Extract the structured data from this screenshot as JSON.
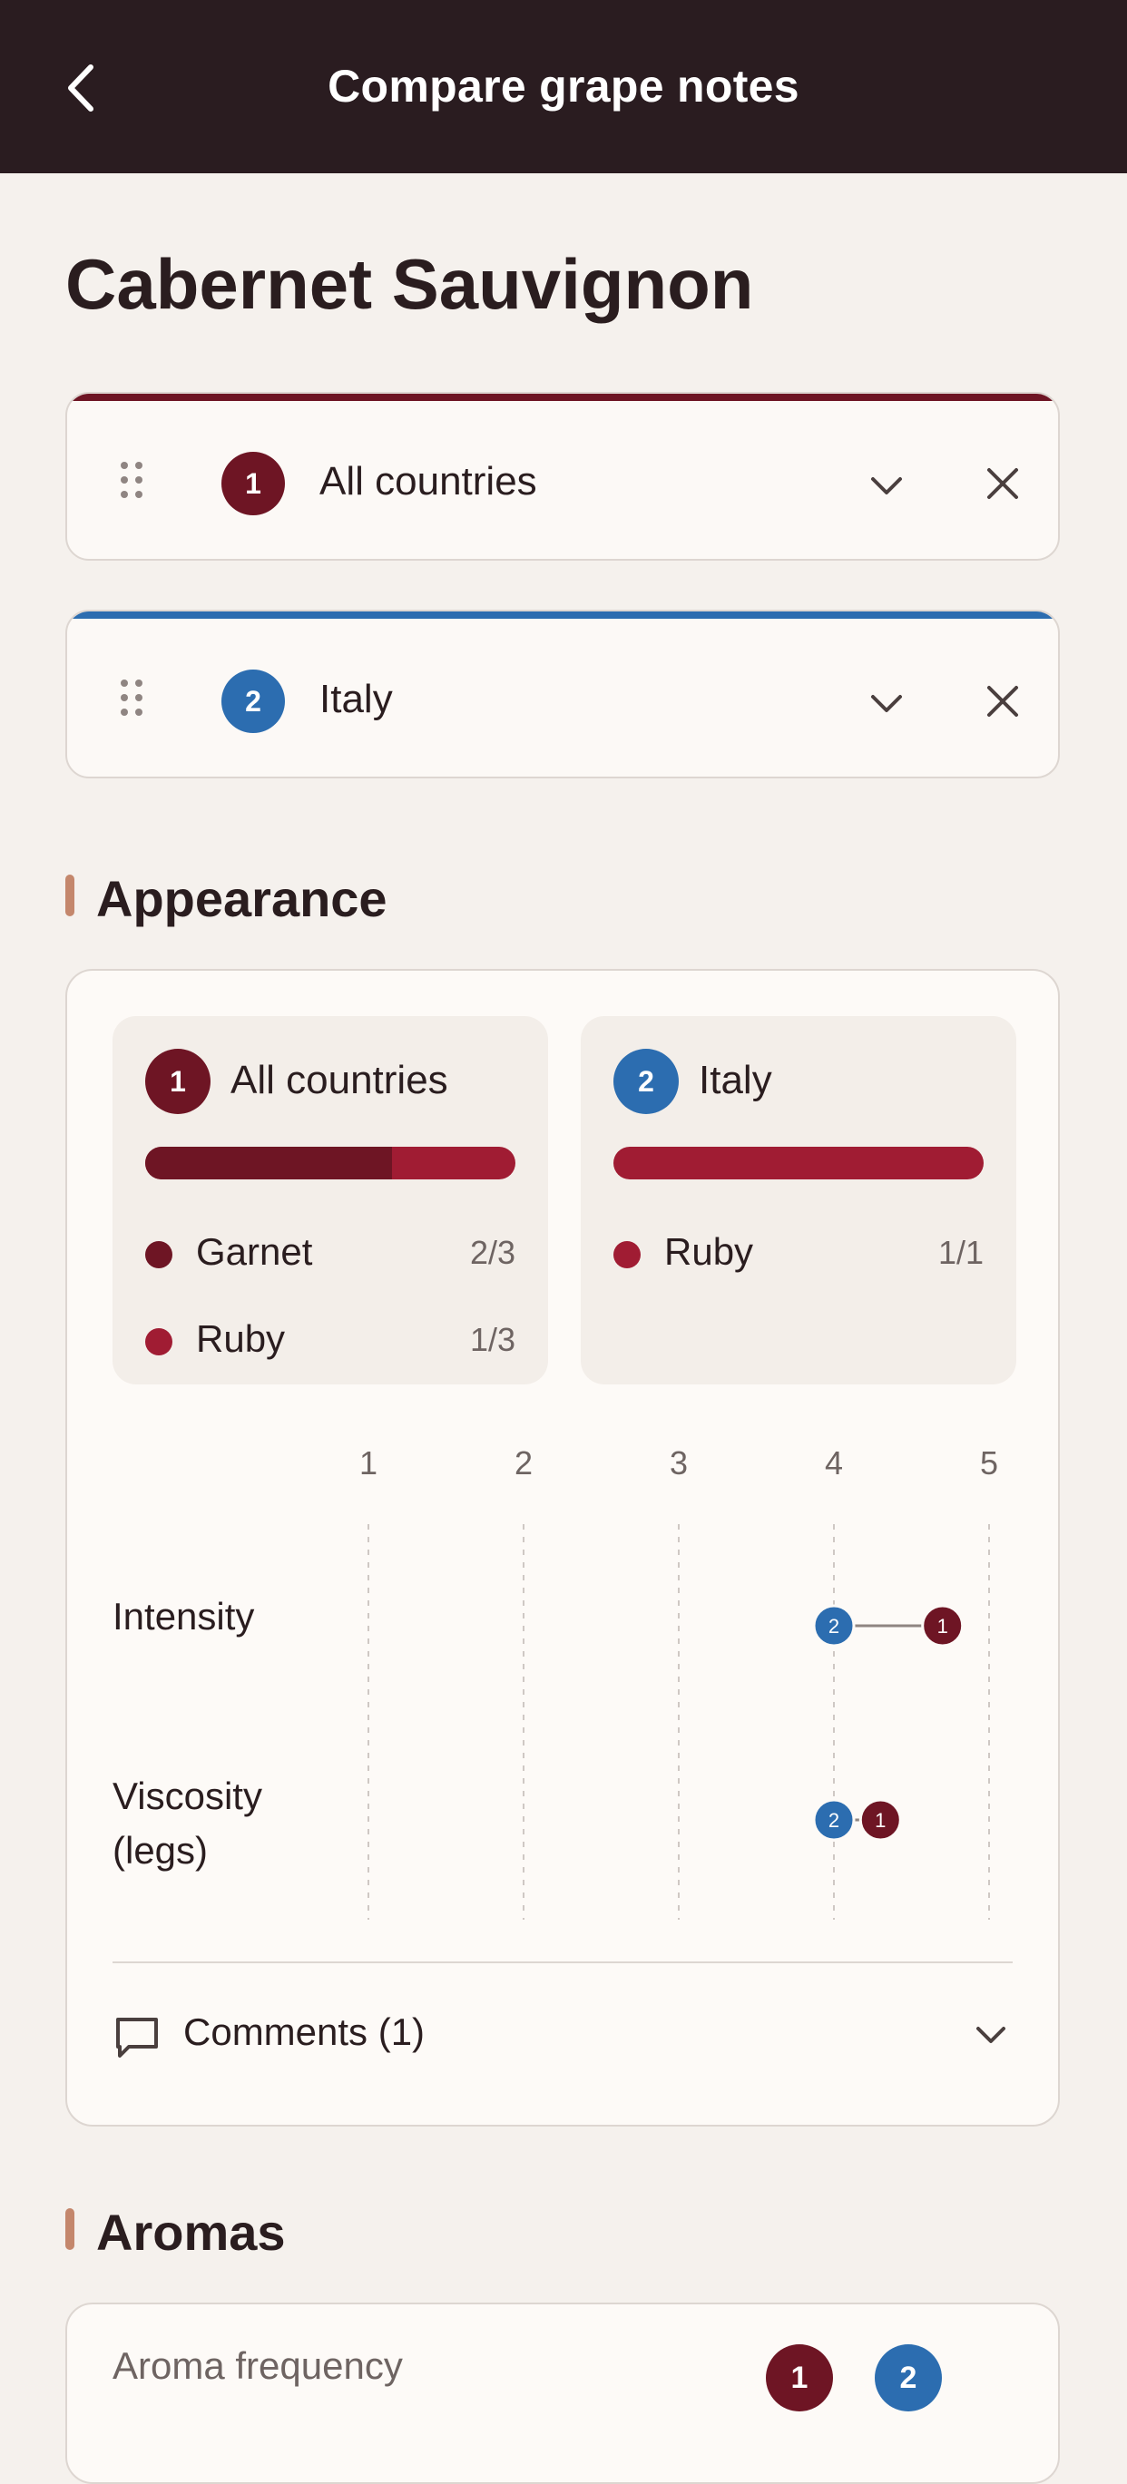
{
  "header": {
    "title": "Compare grape notes",
    "back_icon": "chevron-left-icon"
  },
  "grape": {
    "name": "Cabernet Sauvignon"
  },
  "colors": {
    "wine_dark": "#6e1524",
    "wine_red": "#a01c33",
    "blue": "#2c6db0",
    "accent_mark": "#c4876c",
    "header_bg": "#2a1c20"
  },
  "selectors": [
    {
      "number": "1",
      "label": "All countries"
    },
    {
      "number": "2",
      "label": "Italy"
    }
  ],
  "appearance": {
    "title": "Appearance",
    "groups": [
      {
        "number": "1",
        "label": "All countries",
        "colors": [
          {
            "name": "Garnet",
            "count": "2/3",
            "fraction": 0.667
          },
          {
            "name": "Ruby",
            "count": "1/3",
            "fraction": 0.333
          }
        ]
      },
      {
        "number": "2",
        "label": "Italy",
        "colors": [
          {
            "name": "Ruby",
            "count": "1/1",
            "fraction": 1.0
          }
        ]
      }
    ],
    "scale": {
      "ticks": [
        "1",
        "2",
        "3",
        "4",
        "5"
      ],
      "min": 1,
      "max": 5
    },
    "rows": [
      {
        "label": "Intensity",
        "value_1": 4.7,
        "value_2": 4.0
      },
      {
        "label": "Viscosity (legs)",
        "value_1": 4.3,
        "value_2": 4.0
      }
    ],
    "comments_label": "Comments (1)"
  },
  "aromas": {
    "title": "Aromas",
    "frequency_label": "Aroma frequency",
    "badges": [
      "1",
      "2"
    ]
  }
}
